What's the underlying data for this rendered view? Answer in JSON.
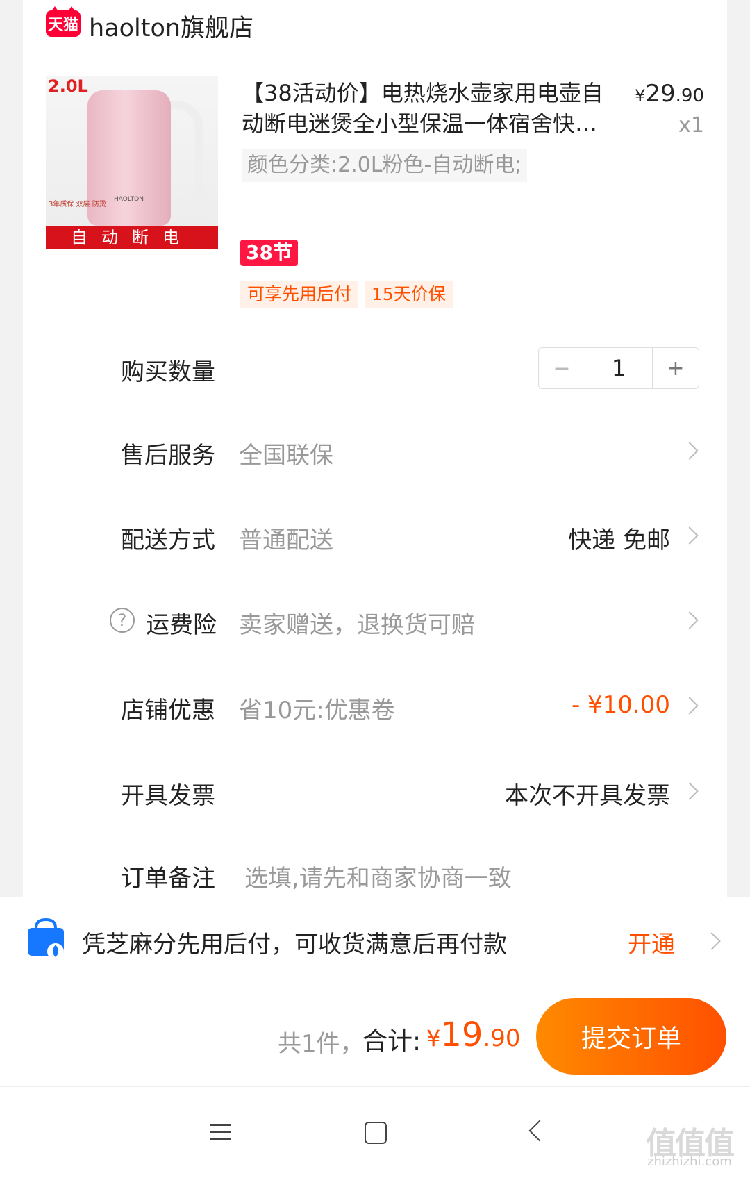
{
  "store": {
    "logo_text": "天猫",
    "name": "haolton旗舰店"
  },
  "product": {
    "image_caption": "2.0L",
    "image_brand": "HAOLTON",
    "image_side_text": "3年质保 双层 防烫",
    "image_banner": "自动断电",
    "title": "【38活动价】电热烧水壶家用电壶自动断电迷煲全小型保温一体宿舍快…",
    "price_currency": "¥",
    "price_int": "29",
    "price_dec": ".90",
    "quantity_label": "x1",
    "sku": "颜色分类:2.0L粉色-自动断电;",
    "badge": "38节",
    "tags": [
      "可享先用后付",
      "15天价保"
    ]
  },
  "rows": {
    "quantity": {
      "label": "购买数量",
      "value": "1",
      "minus": "−",
      "plus": "+"
    },
    "after_sales": {
      "label": "售后服务",
      "value": "全国联保"
    },
    "delivery": {
      "label": "配送方式",
      "value": "普通配送",
      "right": "快递 免邮"
    },
    "shipping_insurance": {
      "label": "运费险",
      "value": "卖家赠送，退换货可赔",
      "icon": "?"
    },
    "store_discount": {
      "label": "店铺优惠",
      "value": "省10元:优惠卷",
      "right": "- ¥10.00"
    },
    "invoice": {
      "label": "开具发票",
      "right": "本次不开具发票"
    },
    "note": {
      "label": "订单备注",
      "placeholder": "选填,请先和商家协商一致"
    }
  },
  "zhima": {
    "text": "凭芝麻分先用后付，可收货满意后再付款",
    "action": "开通"
  },
  "footer": {
    "count_text": "共1件，",
    "total_label": "合计:",
    "total_currency": "¥",
    "total_int": "19",
    "total_dec": ".90",
    "submit": "提交订单"
  },
  "watermark": {
    "main": "值值值",
    "sub": "zhizhizhi.com"
  },
  "colors": {
    "accent": "#ff5000",
    "tmall_red": "#ff0036"
  }
}
